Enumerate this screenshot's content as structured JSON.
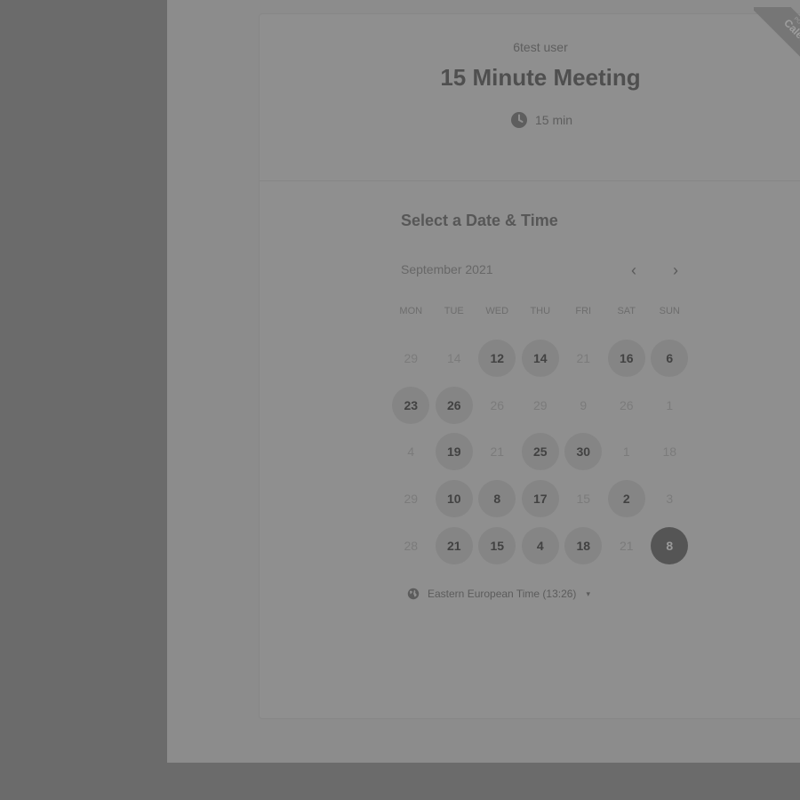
{
  "event": {
    "host": "6test user",
    "title": "15 Minute Meeting",
    "duration": "15 min",
    "ribbon_small": "POWERED BY",
    "ribbon_big": "Calendly"
  },
  "scheduler": {
    "section_title": "Select a Date & Time",
    "month_label": "September 2021",
    "prev_label": "‹",
    "next_label": "›",
    "weekdays": [
      "MON",
      "TUE",
      "WED",
      "THU",
      "FRI",
      "SAT",
      "SUN"
    ],
    "weeks": [
      [
        {
          "d": "29",
          "s": "off"
        },
        {
          "d": "14",
          "s": "off"
        },
        {
          "d": "12",
          "s": "on"
        },
        {
          "d": "14",
          "s": "on"
        },
        {
          "d": "21",
          "s": "off"
        },
        {
          "d": "16",
          "s": "on"
        },
        {
          "d": "6",
          "s": "on"
        }
      ],
      [
        {
          "d": "23",
          "s": "on"
        },
        {
          "d": "26",
          "s": "on"
        },
        {
          "d": "26",
          "s": "off"
        },
        {
          "d": "29",
          "s": "off"
        },
        {
          "d": "9",
          "s": "off"
        },
        {
          "d": "26",
          "s": "off"
        },
        {
          "d": "1",
          "s": "off"
        }
      ],
      [
        {
          "d": "4",
          "s": "off"
        },
        {
          "d": "19",
          "s": "on"
        },
        {
          "d": "21",
          "s": "off"
        },
        {
          "d": "25",
          "s": "on"
        },
        {
          "d": "30",
          "s": "on"
        },
        {
          "d": "1",
          "s": "off"
        },
        {
          "d": "18",
          "s": "off"
        }
      ],
      [
        {
          "d": "29",
          "s": "off"
        },
        {
          "d": "10",
          "s": "on"
        },
        {
          "d": "8",
          "s": "on"
        },
        {
          "d": "17",
          "s": "on"
        },
        {
          "d": "15",
          "s": "off"
        },
        {
          "d": "2",
          "s": "on"
        },
        {
          "d": "3",
          "s": "off"
        }
      ],
      [
        {
          "d": "28",
          "s": "off"
        },
        {
          "d": "21",
          "s": "on"
        },
        {
          "d": "15",
          "s": "on"
        },
        {
          "d": "4",
          "s": "on"
        },
        {
          "d": "18",
          "s": "on"
        },
        {
          "d": "21",
          "s": "off"
        },
        {
          "d": "8",
          "s": "selected"
        }
      ]
    ],
    "timezone": "Eastern European Time (13:26)",
    "timezone_caret": "▾"
  }
}
